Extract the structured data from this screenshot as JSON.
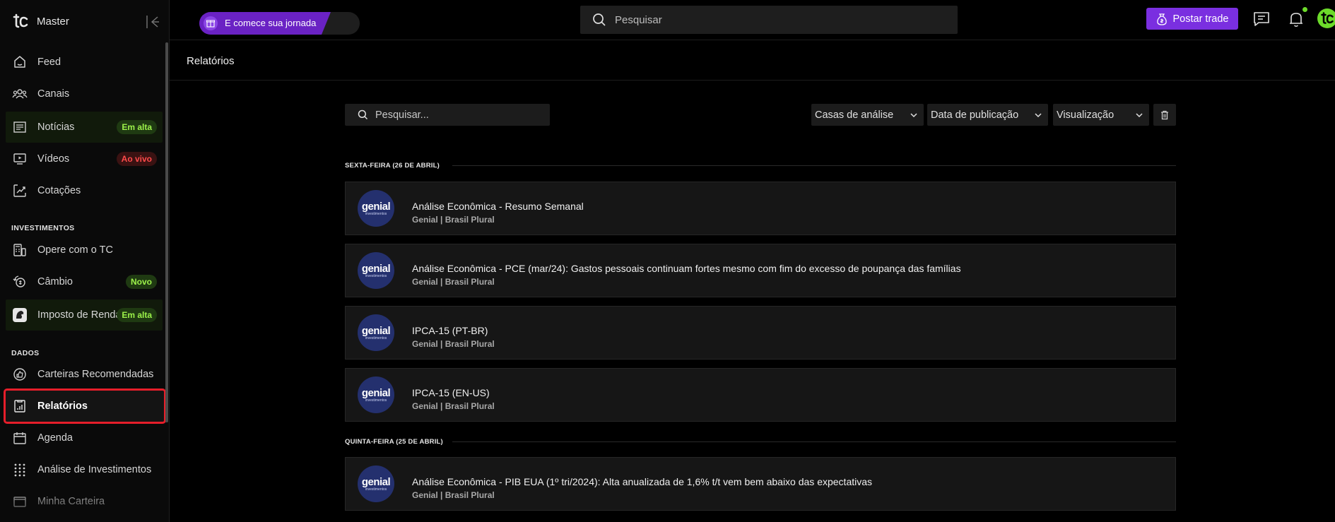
{
  "sidebar": {
    "brand": "Master",
    "items": [
      {
        "label": "Feed",
        "icon": "home-icon"
      },
      {
        "label": "Canais",
        "icon": "users-icon"
      },
      {
        "label": "Notícias",
        "icon": "news-icon",
        "badge": "Em alta"
      },
      {
        "label": "Vídeos",
        "icon": "video-icon",
        "badge": "Ao vivo"
      },
      {
        "label": "Cotações",
        "icon": "chart-icon"
      },
      {
        "label": "Opere com o TC",
        "icon": "calculator-icon"
      },
      {
        "label": "Câmbio",
        "icon": "exchange-icon",
        "badge": "Novo"
      },
      {
        "label": "Imposto de Renda",
        "icon": "lion-icon",
        "badge": "Em alta"
      },
      {
        "label": "Carteiras Recomendadas",
        "icon": "thumbs-up-icon"
      },
      {
        "label": "Relatórios",
        "icon": "report-icon"
      },
      {
        "label": "Agenda",
        "icon": "calendar-icon"
      },
      {
        "label": "Análise de Investimentos",
        "icon": "grid-dots-icon"
      },
      {
        "label": "Minha Carteira",
        "icon": "wallet-icon"
      }
    ],
    "sections": {
      "investimentos": "INVESTIMENTOS",
      "dados": "DADOS"
    }
  },
  "topbar": {
    "journey_label": "E comece sua jornada",
    "search_placeholder": "Pesquisar",
    "post_trade_label": "Postar trade"
  },
  "page": {
    "title": "Relatórios",
    "search_placeholder": "Pesquisar...",
    "filters": {
      "houses": "Casas de análise",
      "date": "Data de publicação",
      "view": "Visualização"
    },
    "groups": [
      {
        "date": "SEXTA-FEIRA (26 DE ABRIL)"
      },
      {
        "date": "QUINTA-FEIRA (25 DE ABRIL)"
      }
    ],
    "logo": {
      "main": "genial",
      "sub": "investimentos"
    },
    "reports": [
      {
        "title": "Análise Econômica - Resumo Semanal",
        "source": "Genial | Brasil Plural"
      },
      {
        "title": "Análise Econômica - PCE (mar/24): Gastos pessoais continuam fortes mesmo com fim do excesso de poupança das famílias",
        "source": "Genial | Brasil Plural"
      },
      {
        "title": "IPCA-15 (PT-BR)",
        "source": "Genial | Brasil Plural"
      },
      {
        "title": "IPCA-15 (EN-US)",
        "source": "Genial | Brasil Plural"
      },
      {
        "title": "Análise Econômica - PIB EUA (1º tri/2024): Alta anualizada de 1,6% t/t vem bem abaixo das expectativas",
        "source": "Genial | Brasil Plural"
      }
    ]
  },
  "colors": {
    "accent_purple": "#7a2fe0",
    "badge_green": "#9cf24a",
    "badge_red": "#ff4a4a",
    "highlight_red": "#e61e2a",
    "brand_green": "#6cdb2a"
  }
}
